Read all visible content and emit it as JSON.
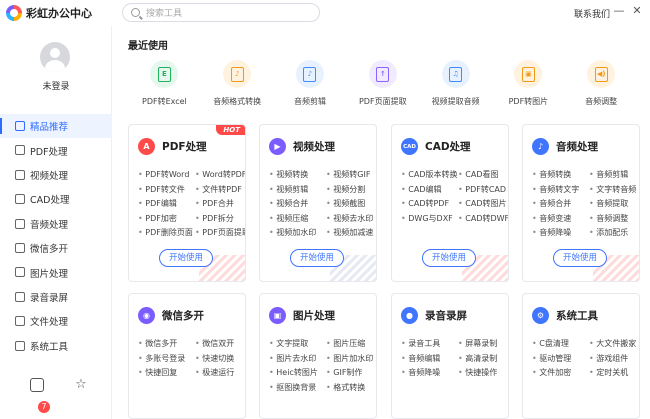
{
  "app": {
    "title": "彩虹办公中心"
  },
  "search": {
    "placeholder": "搜索工具"
  },
  "header": {
    "contact": "联系我们",
    "minimize": "—",
    "close": "✕"
  },
  "user": {
    "login_text": "未登录"
  },
  "sidebar": {
    "items": [
      {
        "label": "精品推荐",
        "active": true
      },
      {
        "label": "PDF处理"
      },
      {
        "label": "视频处理"
      },
      {
        "label": "CAD处理"
      },
      {
        "label": "音频处理"
      },
      {
        "label": "微信多开"
      },
      {
        "label": "图片处理"
      },
      {
        "label": "录音录屏"
      },
      {
        "label": "文件处理"
      },
      {
        "label": "系统工具"
      }
    ],
    "notification_count": "7"
  },
  "recent": {
    "title": "最近使用",
    "items": [
      {
        "label": "PDF转Excel",
        "icon": "excel-icon",
        "glyph": "E",
        "bg": "#e6f8ee",
        "fg": "#22b35e"
      },
      {
        "label": "音频格式转换",
        "icon": "audio-convert-icon",
        "glyph": "♪",
        "bg": "#fff3e0",
        "fg": "#f29a18"
      },
      {
        "label": "音频剪辑",
        "icon": "audio-cut-icon",
        "glyph": "♪",
        "bg": "#e8f2ff",
        "fg": "#3f8cff"
      },
      {
        "label": "PDF页面提取",
        "icon": "pdf-extract-icon",
        "glyph": "↑",
        "bg": "#f1ebff",
        "fg": "#8a64ff"
      },
      {
        "label": "视频提取音频",
        "icon": "video-audio-icon",
        "glyph": "♫",
        "bg": "#e8f2ff",
        "fg": "#3f8cff"
      },
      {
        "label": "PDF转图片",
        "icon": "pdf-image-icon",
        "glyph": "▣",
        "bg": "#fff3e0",
        "fg": "#f29a18"
      },
      {
        "label": "音频调整",
        "icon": "audio-adjust-icon",
        "glyph": "◀)",
        "bg": "#fff3e0",
        "fg": "#f29a18"
      }
    ]
  },
  "cards": [
    {
      "title": "PDF处理",
      "icon": "pdf-icon",
      "glyph": "A",
      "color": "#ff4a4a",
      "hot": "HOT",
      "features": [
        "PDF转Word",
        "Word转PDF",
        "PDF转文件",
        "文件转PDF",
        "PDF编辑",
        "PDF合并",
        "PDF加密",
        "PDF拆分",
        "PDF删除页面",
        "PDF页面提取"
      ],
      "button": "开始使用"
    },
    {
      "title": "视频处理",
      "icon": "video-icon",
      "glyph": "▶",
      "color": "#7b5cff",
      "features": [
        "视频转换",
        "视频转GIF",
        "视频剪辑",
        "视频分割",
        "视频合并",
        "视频截图",
        "视频压缩",
        "视频去水印",
        "视频加水印",
        "视频加减速"
      ],
      "button": "开始使用"
    },
    {
      "title": "CAD处理",
      "icon": "cad-icon",
      "glyph": "CAD",
      "color": "#3f75ff",
      "features": [
        "CAD版本转换",
        "CAD看图",
        "CAD编辑",
        "PDF转CAD",
        "CAD转PDF",
        "CAD转图片",
        "DWG与DXF",
        "CAD转DWF"
      ],
      "button": "开始使用"
    },
    {
      "title": "音频处理",
      "icon": "audio-icon",
      "glyph": "♪",
      "color": "#3f75ff",
      "features": [
        "音频转换",
        "音频剪辑",
        "音频转文字",
        "文字转音频",
        "音频合并",
        "音频提取",
        "音频变速",
        "音频调整",
        "音频降噪",
        "添加配乐"
      ],
      "button": "开始使用"
    },
    {
      "title": "微信多开",
      "icon": "wechat-icon",
      "glyph": "◉",
      "color": "#7b5cff",
      "features": [
        "微信多开",
        "微信双开",
        "多账号登录",
        "快速切换",
        "快捷回复",
        "极速运行"
      ]
    },
    {
      "title": "图片处理",
      "icon": "image-icon",
      "glyph": "▣",
      "color": "#7b5cff",
      "features": [
        "文字提取",
        "图片压缩",
        "图片去水印",
        "图片加水印",
        "Heic转图片",
        "GIF制作",
        "抠图换背景",
        "格式转换"
      ]
    },
    {
      "title": "录音录屏",
      "icon": "microphone-icon",
      "glyph": "●",
      "color": "#3f75ff",
      "features": [
        "录音工具",
        "屏幕录制",
        "音频编辑",
        "高清录制",
        "音频降噪",
        "快捷操作"
      ]
    },
    {
      "title": "系统工具",
      "icon": "system-gear-icon",
      "glyph": "⚙",
      "color": "#3f75ff",
      "features": [
        "C盘清理",
        "大文件搬家",
        "驱动管理",
        "游戏组件",
        "文件加密",
        "定时关机"
      ]
    }
  ]
}
